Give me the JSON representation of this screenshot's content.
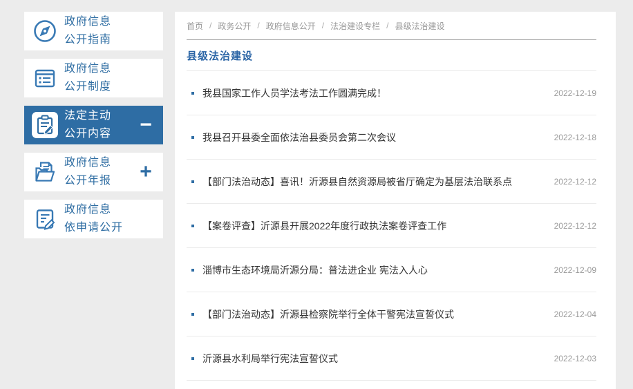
{
  "page": {
    "background_color": "#ececec",
    "accent_color": "#2e6da4",
    "panel_color": "#ffffff"
  },
  "sidebar": {
    "items": [
      {
        "line1": "政府信息",
        "line2": "公开指南",
        "icon": "compass-icon",
        "active": false,
        "toggle": ""
      },
      {
        "line1": "政府信息",
        "line2": "公开制度",
        "icon": "document-list-icon",
        "active": false,
        "toggle": ""
      },
      {
        "line1": "法定主动",
        "line2": "公开内容",
        "icon": "clipboard-pen-icon",
        "active": true,
        "toggle": "−"
      },
      {
        "line1": "政府信息",
        "line2": "公开年报",
        "icon": "folder-report-icon",
        "active": false,
        "toggle": "+"
      },
      {
        "line1": "政府信息",
        "line2": "依申请公开",
        "icon": "document-pen-icon",
        "active": false,
        "toggle": ""
      }
    ]
  },
  "breadcrumb": {
    "separator": "/",
    "items": [
      "首页",
      "政务公开",
      "政府信息公开",
      "法治建设专栏",
      "县级法治建设"
    ]
  },
  "main": {
    "title": "县级法治建设",
    "articles": [
      {
        "title": "我县国家工作人员学法考法工作圆满完成！",
        "date": "2022-12-19"
      },
      {
        "title": "我县召开县委全面依法治县委员会第二次会议",
        "date": "2022-12-18"
      },
      {
        "title": "【部门法治动态】喜讯！沂源县自然资源局被省厅确定为基层法治联系点",
        "date": "2022-12-12"
      },
      {
        "title": "【案卷评查】沂源县开展2022年度行政执法案卷评查工作",
        "date": "2022-12-12"
      },
      {
        "title": "淄博市生态环境局沂源分局：普法进企业 宪法入人心",
        "date": "2022-12-09"
      },
      {
        "title": "【部门法治动态】沂源县检察院举行全体干警宪法宣誓仪式",
        "date": "2022-12-04"
      },
      {
        "title": "沂源县水利局举行宪法宣誓仪式",
        "date": "2022-12-03"
      }
    ]
  }
}
